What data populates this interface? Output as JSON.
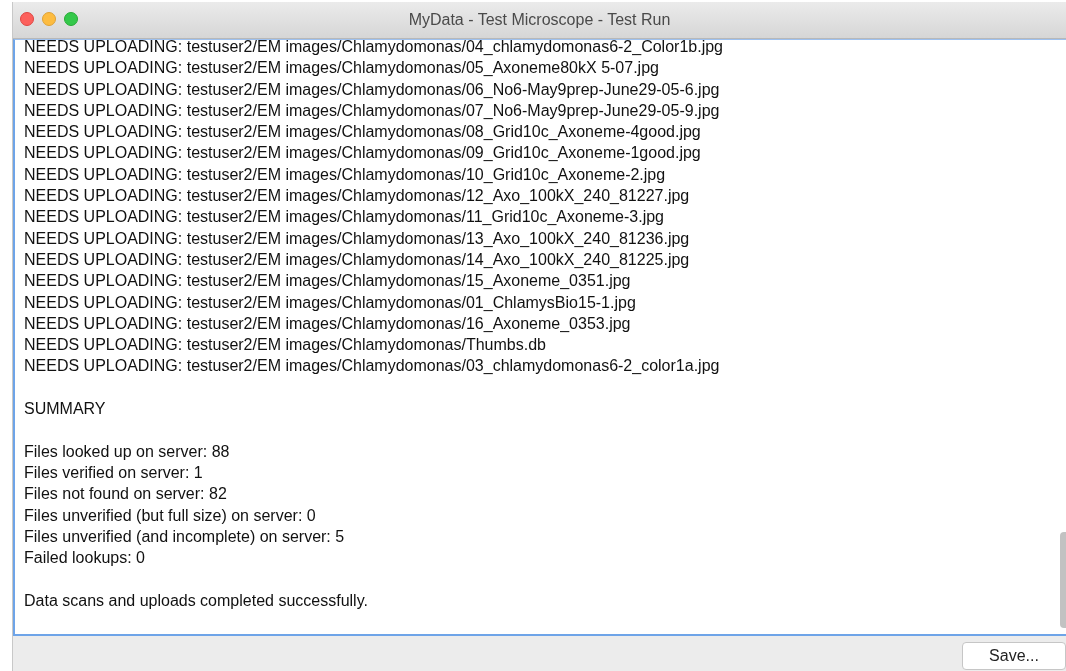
{
  "window": {
    "title": "MyData - Test Microscope - Test Run"
  },
  "log": {
    "paragraphs": [
      [
        "NEEDS UPLOADING: testuser2/EM images/Chlamydomonas/04_chlamydomonas6-2_Color1b.jpg",
        "NEEDS UPLOADING: testuser2/EM images/Chlamydomonas/05_Axoneme80kX 5-07.jpg",
        "NEEDS UPLOADING: testuser2/EM images/Chlamydomonas/06_No6-May9prep-June29-05-6.jpg",
        "NEEDS UPLOADING: testuser2/EM images/Chlamydomonas/07_No6-May9prep-June29-05-9.jpg",
        "NEEDS UPLOADING: testuser2/EM images/Chlamydomonas/08_Grid10c_Axoneme-4good.jpg",
        "NEEDS UPLOADING: testuser2/EM images/Chlamydomonas/09_Grid10c_Axoneme-1good.jpg",
        "NEEDS UPLOADING: testuser2/EM images/Chlamydomonas/10_Grid10c_Axoneme-2.jpg",
        "NEEDS UPLOADING: testuser2/EM images/Chlamydomonas/12_Axo_100kX_240_81227.jpg",
        "NEEDS UPLOADING: testuser2/EM images/Chlamydomonas/11_Grid10c_Axoneme-3.jpg",
        "NEEDS UPLOADING: testuser2/EM images/Chlamydomonas/13_Axo_100kX_240_81236.jpg",
        "NEEDS UPLOADING: testuser2/EM images/Chlamydomonas/14_Axo_100kX_240_81225.jpg",
        "NEEDS UPLOADING: testuser2/EM images/Chlamydomonas/15_Axoneme_0351.jpg",
        "NEEDS UPLOADING: testuser2/EM images/Chlamydomonas/01_ChlamysBio15-1.jpg",
        "NEEDS UPLOADING: testuser2/EM images/Chlamydomonas/16_Axoneme_0353.jpg",
        "NEEDS UPLOADING: testuser2/EM images/Chlamydomonas/Thumbs.db",
        "NEEDS UPLOADING: testuser2/EM images/Chlamydomonas/03_chlamydomonas6-2_color1a.jpg"
      ],
      [
        "SUMMARY"
      ],
      [
        "Files looked up on server: 88",
        "Files verified on server: 1",
        "Files not found on server: 82",
        "Files unverified (but full size) on server: 0",
        "Files unverified (and incomplete) on server: 5",
        "Failed lookups: 0"
      ],
      [
        "Data scans and uploads completed successfully."
      ]
    ]
  },
  "buttons": [
    {
      "label": "Save..."
    }
  ]
}
